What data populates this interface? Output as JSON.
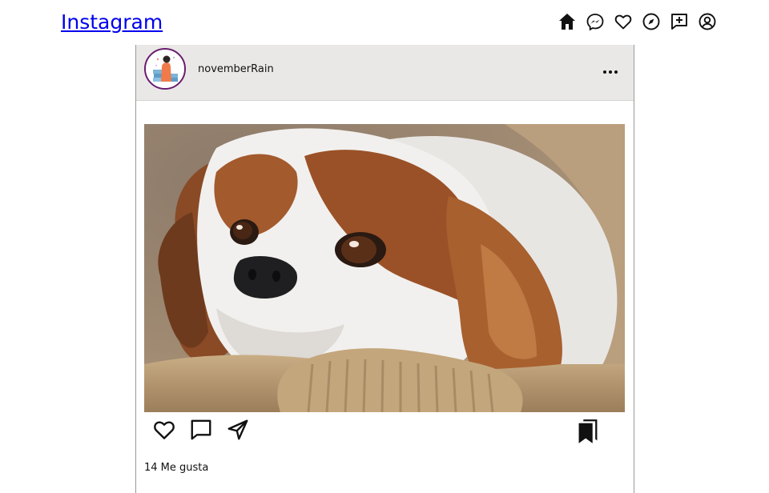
{
  "header": {
    "logo_glyph": "",
    "logo_text": "Instagram",
    "nav_icons": [
      "home-icon",
      "messenger-icon",
      "heart-icon",
      "compass-icon",
      "new-post-icon",
      "profile-icon"
    ]
  },
  "post": {
    "username": "novemberRain",
    "likes_text": "14 Me gusta",
    "photo_subject": "",
    "action_icons": [
      "heart-icon",
      "comment-icon",
      "share-icon"
    ],
    "save_icon": "bookmark-icon"
  },
  "colors": {
    "link": "#0000ee",
    "header_bg": "#e9e8e7",
    "avatar_ring": "#6a1b6e"
  }
}
